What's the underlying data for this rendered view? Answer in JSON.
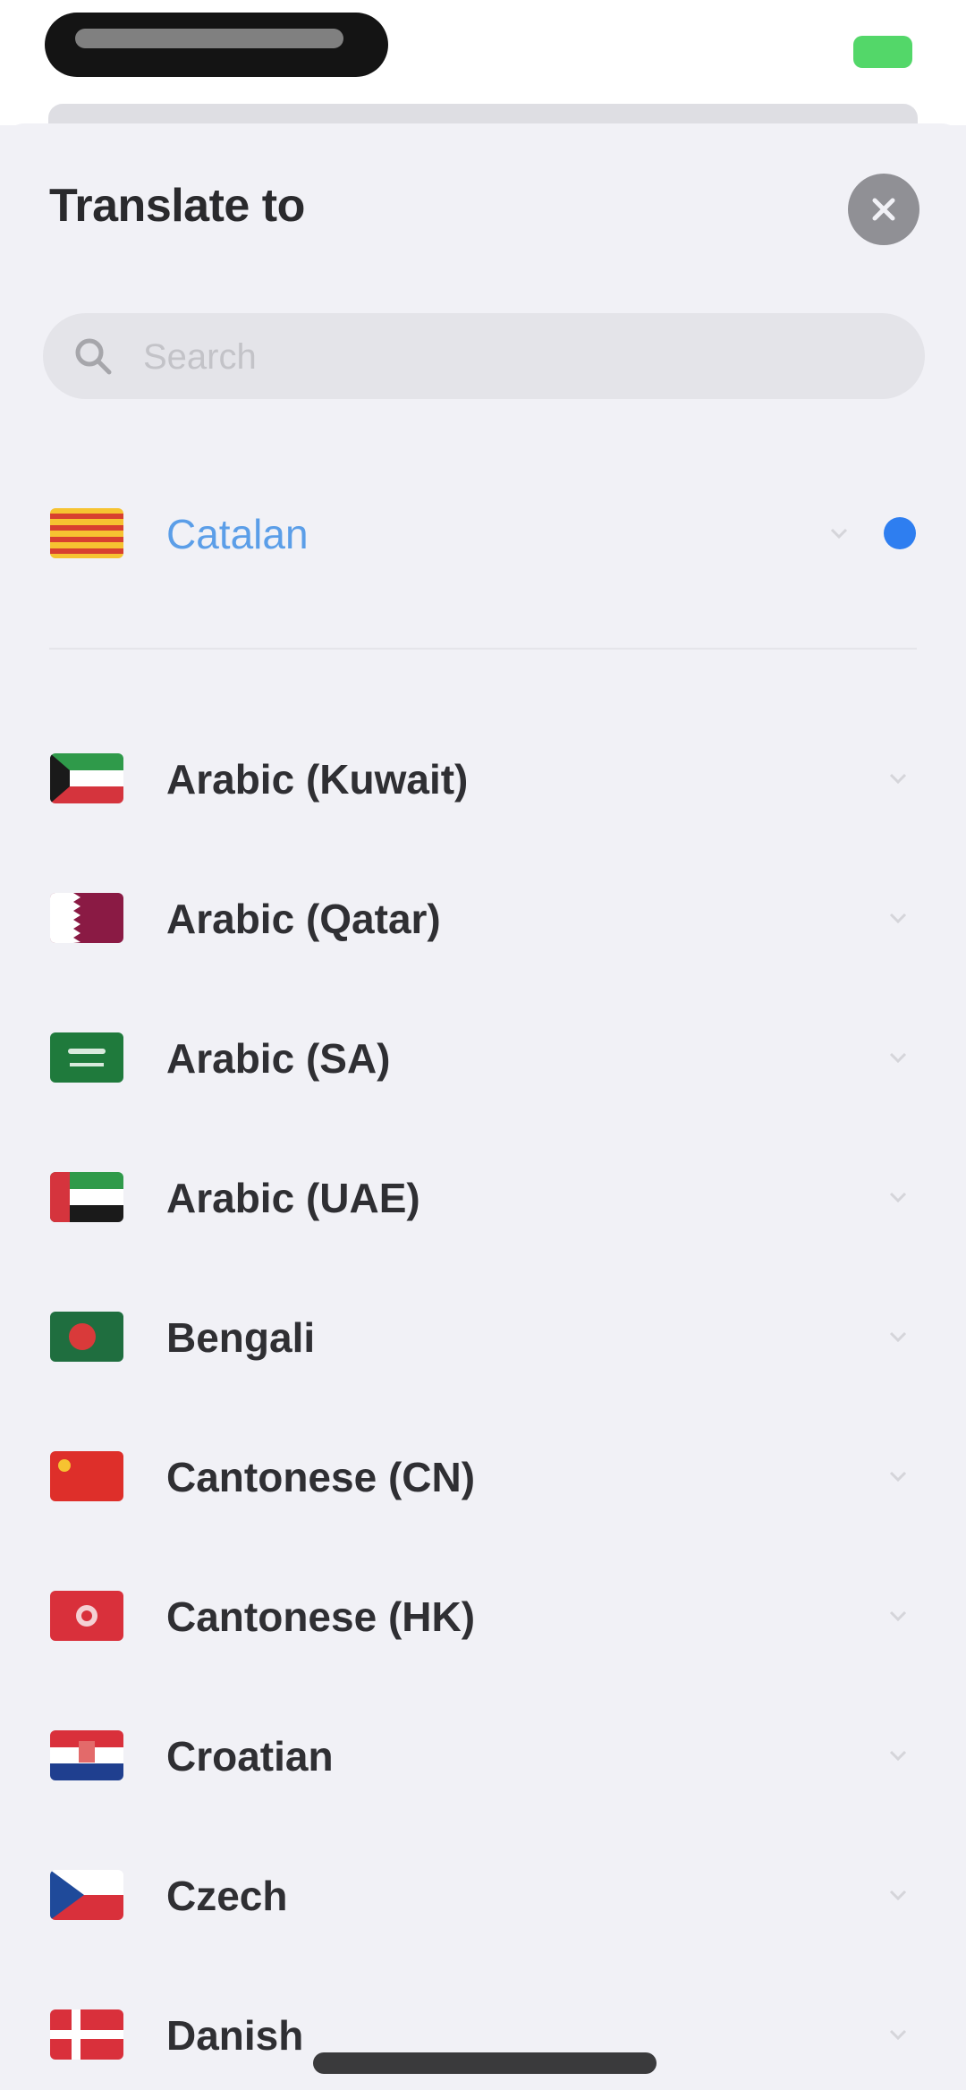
{
  "sheet": {
    "title": "Translate to",
    "search_placeholder": "Search"
  },
  "selected": {
    "label": "Catalan",
    "flag": "flag-catalan"
  },
  "languages": [
    {
      "label": "Arabic (Kuwait)",
      "flag": "flag-kuwait"
    },
    {
      "label": "Arabic (Qatar)",
      "flag": "flag-qatar"
    },
    {
      "label": "Arabic (SA)",
      "flag": "flag-saudi-arabia"
    },
    {
      "label": "Arabic (UAE)",
      "flag": "flag-uae"
    },
    {
      "label": "Bengali",
      "flag": "flag-bangladesh"
    },
    {
      "label": "Cantonese (CN)",
      "flag": "flag-china"
    },
    {
      "label": "Cantonese (HK)",
      "flag": "flag-hong-kong"
    },
    {
      "label": "Croatian",
      "flag": "flag-croatia"
    },
    {
      "label": "Czech",
      "flag": "flag-czech"
    },
    {
      "label": "Danish",
      "flag": "flag-denmark"
    }
  ],
  "colors": {
    "accent": "#2e7ef0",
    "background": "#f1f1f6"
  }
}
